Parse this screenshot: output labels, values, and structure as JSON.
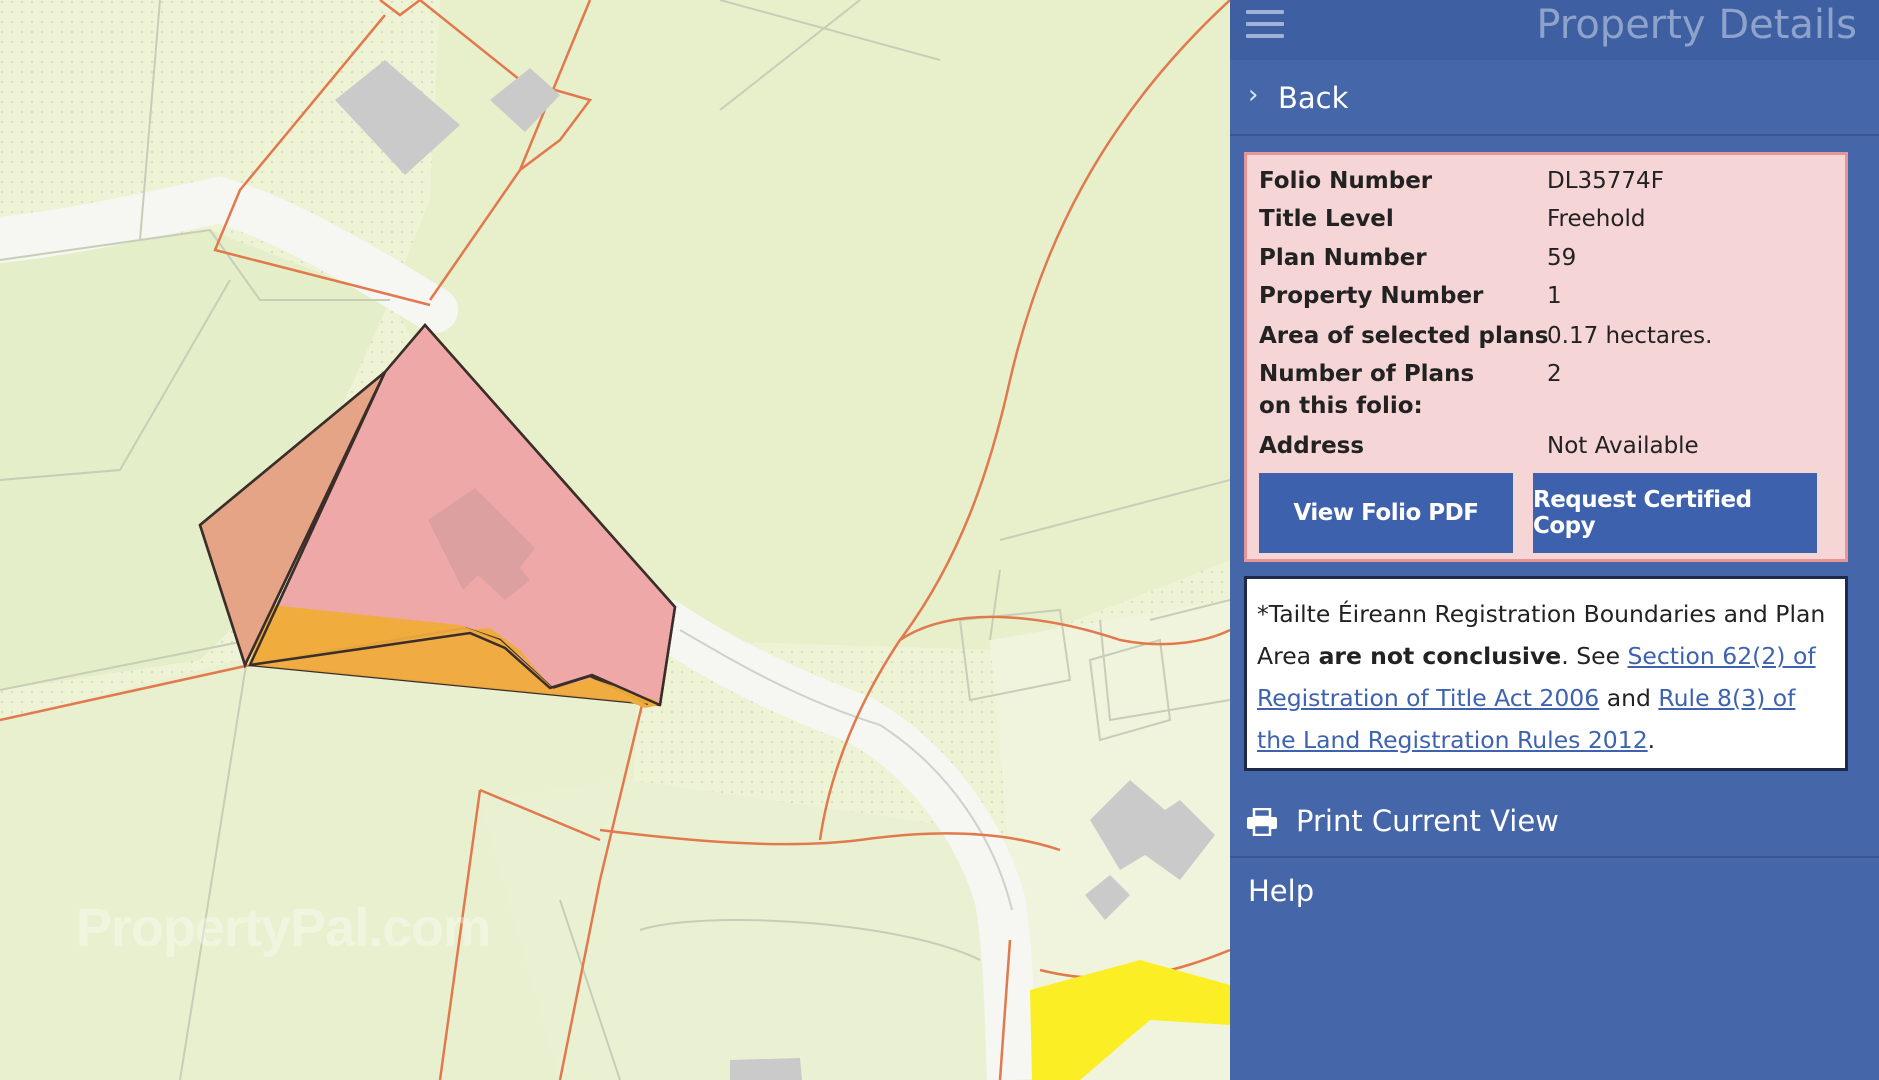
{
  "map": {
    "watermark": "PropertyPal.com",
    "colors": {
      "background": "#eef3d6",
      "field": "#e6efc9",
      "road": "#f4f4f0",
      "boundary": "#e0774a",
      "parcel_line": "#c9d0b8",
      "building": "#c9c9c9",
      "selected_plan": "#eea9a8",
      "adjacent_plan": "#e5a286",
      "strip": "#eeaa3c",
      "yellow_road": "#fbee24"
    }
  },
  "panel": {
    "title": "Property Details",
    "menu_icon": "hamburger-menu-icon",
    "back": {
      "icon": "chevron-right-icon",
      "label": "Back"
    },
    "details": [
      {
        "label": "Folio Number",
        "value": "DL35774F"
      },
      {
        "label": "Title Level",
        "value": "Freehold"
      },
      {
        "label": "Plan Number",
        "value": "59"
      },
      {
        "label": "Property Number",
        "value": "1"
      },
      {
        "label": "Area of selected plans",
        "value": "0.17 hectares."
      },
      {
        "label": "Number of Plans on this folio:",
        "value": "2"
      },
      {
        "label": "Address",
        "value": "Not Available"
      }
    ],
    "buttons": {
      "view_pdf": "View Folio PDF",
      "request_copy": "Request Certified Copy"
    },
    "notice": {
      "prefix": "*Tailte Éireann Registration Boundaries and Plan Area ",
      "emphasis": "are not conclusive",
      "middle": ". See ",
      "link1": "Section 62(2) of Registration of Title Act 2006",
      "conjunction": " and ",
      "link2": "Rule 8(3) of the Land Registration Rules 2012",
      "suffix": "."
    },
    "print": {
      "icon": "printer-icon",
      "label": "Print Current View"
    },
    "help": {
      "label": "Help"
    }
  }
}
